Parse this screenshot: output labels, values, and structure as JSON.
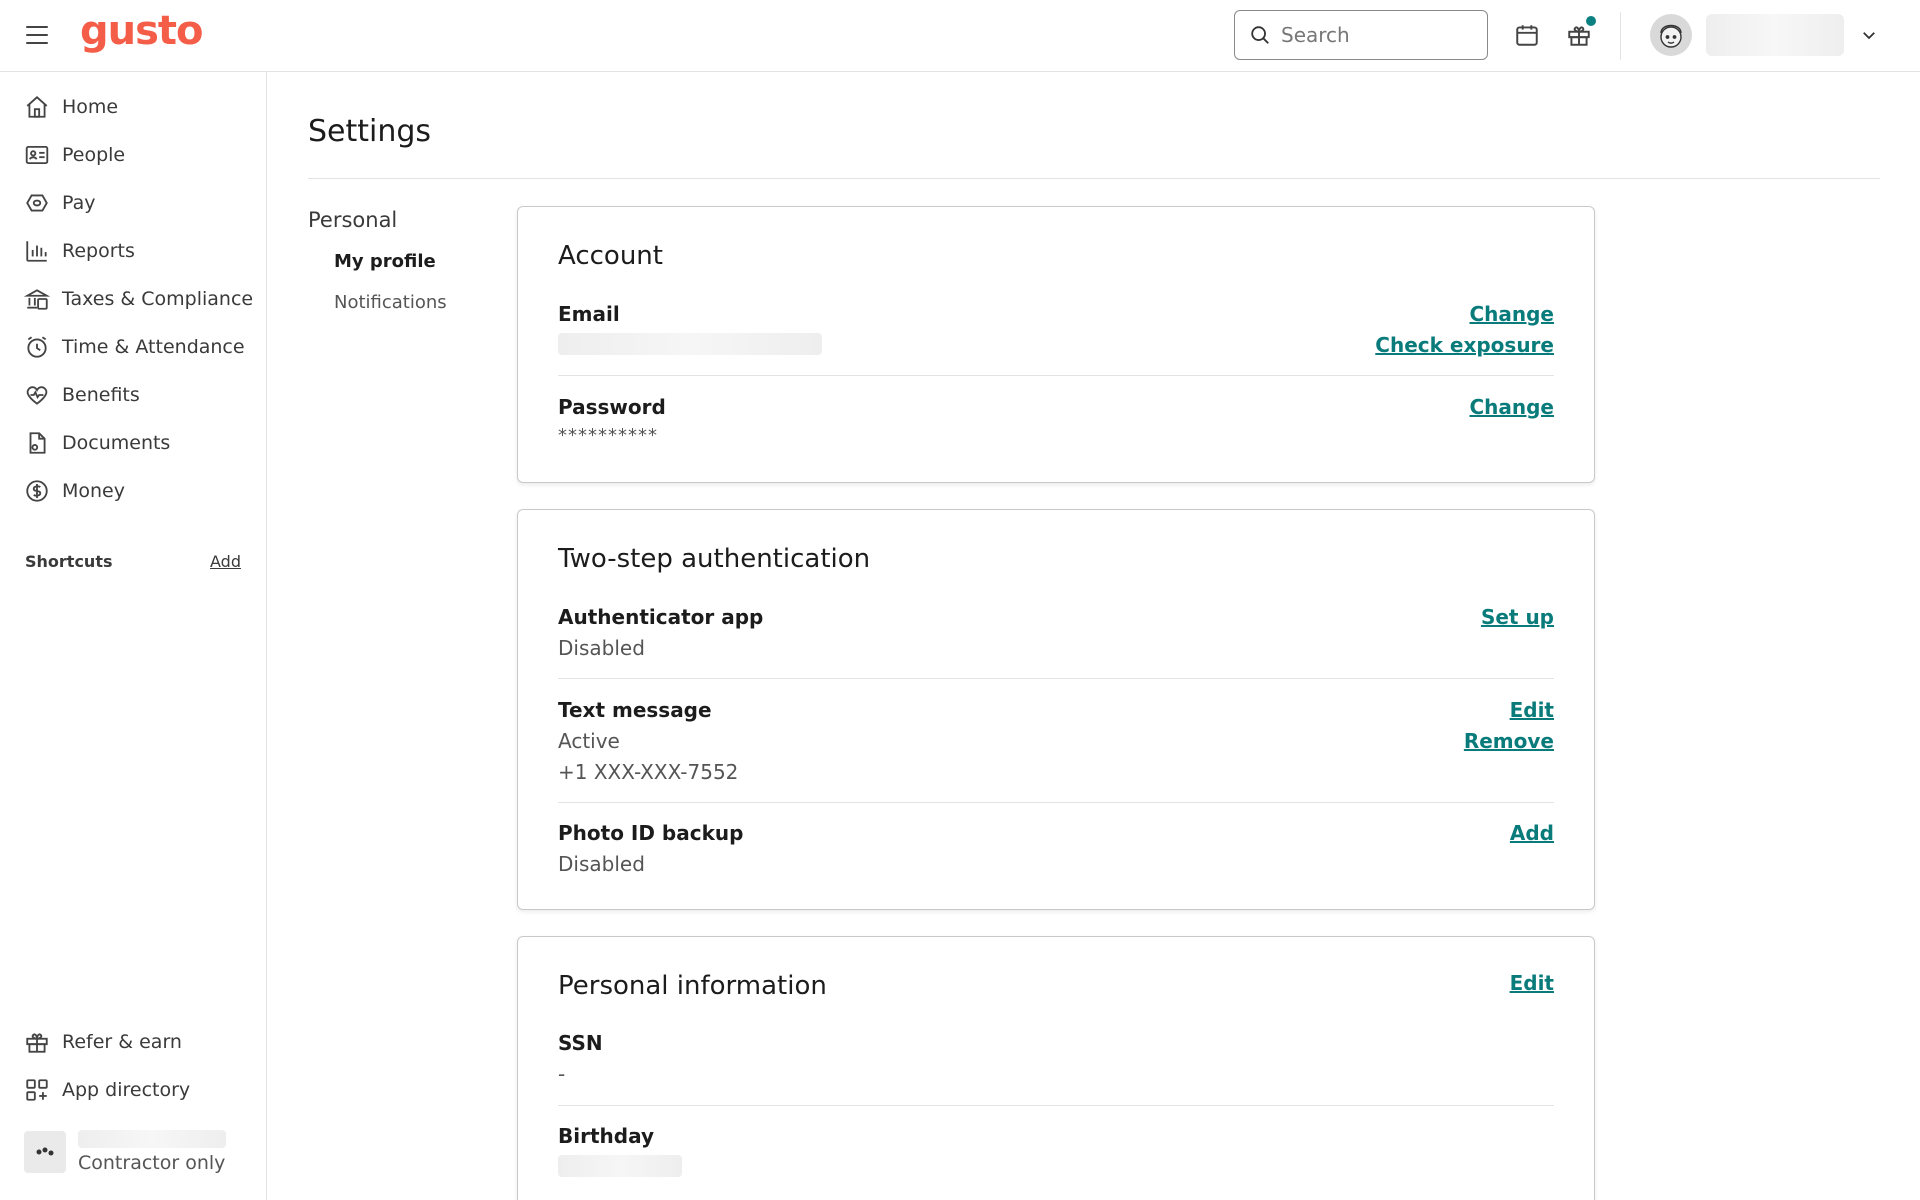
{
  "app": {
    "logo": "gusto"
  },
  "header": {
    "search_placeholder": "Search"
  },
  "sidebar": {
    "items": [
      {
        "label": "Home",
        "icon": "home-icon"
      },
      {
        "label": "People",
        "icon": "id-card-icon"
      },
      {
        "label": "Pay",
        "icon": "pay-icon"
      },
      {
        "label": "Reports",
        "icon": "bar-chart-icon"
      },
      {
        "label": "Taxes & Compliance",
        "icon": "bank-icon"
      },
      {
        "label": "Time & Attendance",
        "icon": "clock-icon"
      },
      {
        "label": "Benefits",
        "icon": "heart-icon"
      },
      {
        "label": "Documents",
        "icon": "document-icon"
      },
      {
        "label": "Money",
        "icon": "dollar-icon"
      }
    ],
    "shortcuts_label": "Shortcuts",
    "shortcuts_add": "Add",
    "bottom_items": [
      {
        "label": "Refer & earn",
        "icon": "gift-icon"
      },
      {
        "label": "App directory",
        "icon": "grid-icon"
      }
    ],
    "company_role": "Contractor only"
  },
  "page": {
    "title": "Settings",
    "subnav": {
      "heading": "Personal",
      "items": [
        "My profile",
        "Notifications"
      ]
    }
  },
  "account": {
    "title": "Account",
    "email_label": "Email",
    "email_change": "Change",
    "email_check": "Check exposure",
    "password_label": "Password",
    "password_value": "**********",
    "password_change": "Change"
  },
  "two_step": {
    "title": "Two-step authentication",
    "authenticator_label": "Authenticator app",
    "authenticator_status": "Disabled",
    "authenticator_action": "Set up",
    "text_label": "Text message",
    "text_status": "Active",
    "text_phone": "+1 XXX-XXX-7552",
    "text_edit": "Edit",
    "text_remove": "Remove",
    "photo_label": "Photo ID backup",
    "photo_status": "Disabled",
    "photo_action": "Add"
  },
  "personal_info": {
    "title": "Personal information",
    "edit": "Edit",
    "ssn_label": "SSN",
    "ssn_value": "-",
    "birthday_label": "Birthday"
  },
  "colors": {
    "brand": "#f45d48",
    "link": "#0a7b7b",
    "notification": "#0a8080"
  }
}
